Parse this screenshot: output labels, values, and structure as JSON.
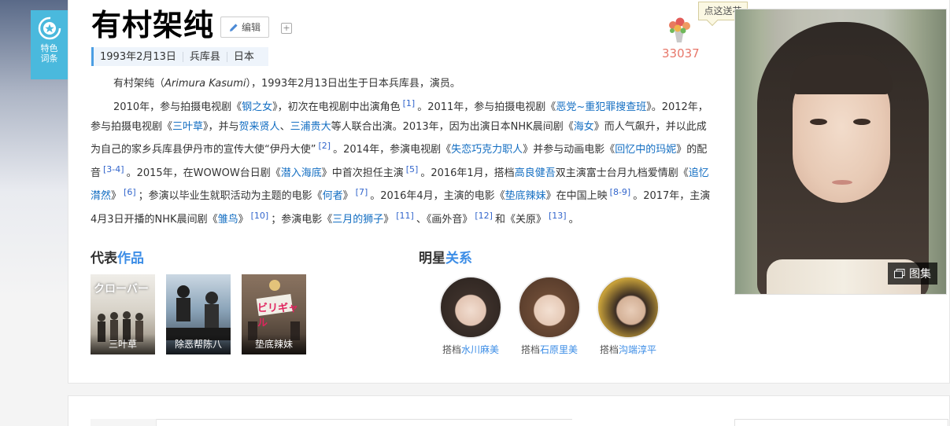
{
  "badge": {
    "line1": "特色",
    "line2": "词条",
    "icon": "target-star-icon"
  },
  "entry": {
    "title": "有村架纯",
    "edit_label": "编辑",
    "add_label": "+",
    "summary": [
      "1993年2月13日",
      "兵库县",
      "日本"
    ]
  },
  "flowers": {
    "tooltip": "点这送花",
    "count": "33037",
    "icon": "bouquet-icon"
  },
  "gallery": {
    "label": "图集",
    "icon": "gallery-icon"
  },
  "intro": {
    "p1": {
      "a": "有村架纯（",
      "name_en": "Arimura Kasumi",
      "b": "），1993年2月13日出生于日本兵库县，演员。"
    },
    "p2": {
      "t1": "2010年，参与拍摄电视剧《",
      "l1": "钢之女",
      "t2": "》，初次在电视剧中出演角色",
      "r1": "[1]",
      "t3": "。2011年，参与拍摄电视剧《",
      "l2": "恶党~重犯罪搜查班",
      "t4": "》。2012年，参与拍摄电视剧《",
      "l3": "三叶草",
      "t5": "》，并与",
      "l4": "贺来贤人",
      "t6": "、",
      "l5": "三浦贵大",
      "t7": "等人联合出演。2013年，因为出演日本NHK晨间剧《",
      "l6": "海女",
      "t8": "》而人气飙升，并以此成为自己的家乡兵库县伊丹市的宣传大使“伊丹大使”",
      "r2": "[2]",
      "t9": "。2014年，参演电视剧《",
      "l7": "失恋巧克力职人",
      "t10": "》并参与动画电影《",
      "l8": "回忆中的玛妮",
      "t11": "》的配音",
      "r3": "[3-4]",
      "t12": "。2015年，在WOWOW台日剧《",
      "l9": "潜入海底",
      "t13": "》中首次担任主演",
      "r4": "[5]",
      "t14": "。2016年1月，搭档",
      "l10": "高良健吾",
      "t15": "双主演富士台月九档爱情剧《",
      "l11": "追忆潸然",
      "t16": "》",
      "r5": "[6]",
      "t17": "；参演以毕业生就职活动为主题的电影《",
      "l12": "何者",
      "t18": "》",
      "r6": "[7]",
      "t19": "。2016年4月，主演的电影《",
      "l13": "垫底辣妹",
      "t20": "》在中国上映",
      "r7": "[8-9]",
      "t21": "。2017年，主演4月3日开播的NHK晨间剧《",
      "l14": "雏鸟",
      "t22": "》",
      "r8": "[10]",
      "t23": "；参演电影《",
      "l15": "三月的狮子",
      "t24": "》",
      "r9": "[11]",
      "t25": "、《画外音》",
      "r10": "[12]",
      "t26": "和《关原》",
      "r11": "[13]",
      "t27": "。"
    }
  },
  "works": {
    "title_a": "代表",
    "title_b": "作品",
    "items": [
      {
        "caption": "三叶草",
        "poster_text": "クローバー",
        "bg": "#dedad3"
      },
      {
        "caption": "除恶帮陈八",
        "poster_text": "",
        "bg": "#6e88a0"
      },
      {
        "caption": "垫底辣妹",
        "poster_text": "ビリギャル",
        "bg": "#7a6552"
      }
    ]
  },
  "relations": {
    "title_a": "明星",
    "title_b": "关系",
    "items": [
      {
        "prefix": "搭档",
        "name": "水川麻美"
      },
      {
        "prefix": "搭档",
        "name": "石原里美"
      },
      {
        "prefix": "搭档",
        "name": "沟端淳平"
      }
    ]
  },
  "colors": {
    "accent": "#4ab9dd",
    "link": "#136ec2",
    "flower": "#e7776a",
    "section_hl": "#3c8de6"
  }
}
